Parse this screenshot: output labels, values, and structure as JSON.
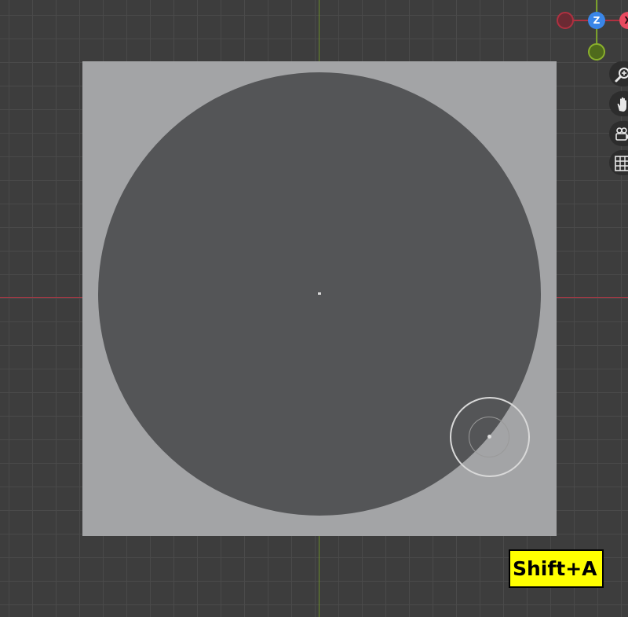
{
  "viewport": {
    "background_color": "#3d3d3d",
    "grid_color": "#4a4a4a",
    "x_axis_color": "#9a3a45",
    "y_axis_color": "#6a8a2a"
  },
  "image_plane": {
    "background_color": "#a3a4a6",
    "disc_color": "#545557"
  },
  "gizmo": {
    "z_label": "Z",
    "x_label": "X",
    "z_color": "#3a86e8",
    "x_color": "#e84a5f",
    "y_color": "#8ab02c"
  },
  "toolbar": {
    "tools": [
      {
        "icon": "zoom-icon"
      },
      {
        "icon": "pan-hand-icon"
      },
      {
        "icon": "camera-icon"
      },
      {
        "icon": "grid-icon"
      }
    ]
  },
  "brush": {
    "icon": "brush-cursor-icon"
  },
  "key_overlay": {
    "text": "Shift+A",
    "background_color": "#ffff00"
  }
}
